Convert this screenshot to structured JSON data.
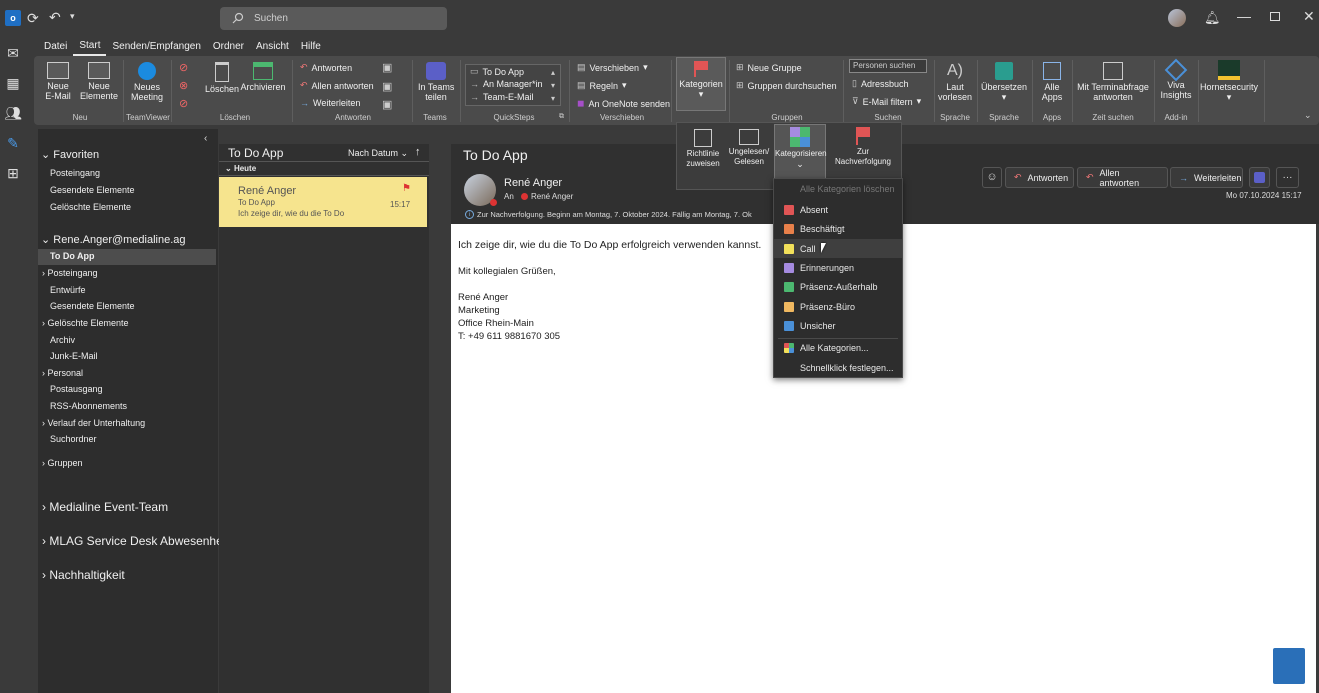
{
  "titlebar": {
    "search_placeholder": "Suchen"
  },
  "menu": [
    "Datei",
    "Start",
    "Senden/Empfangen",
    "Ordner",
    "Ansicht",
    "Hilfe"
  ],
  "ribbon": {
    "new_mail": "Neue\nE-Mail",
    "new_items": "Neue\nElemente",
    "new_meeting": "Neues\nMeeting",
    "delete": "Löschen",
    "archive": "Archivieren",
    "reply": "Antworten",
    "reply_all": "Allen antworten",
    "forward": "Weiterleiten",
    "teams_share": "In Teams\nteilen",
    "qs1": "To Do App",
    "qs2": "An Manager*in",
    "qs3": "Team-E-Mail",
    "move": "Verschieben",
    "rules": "Regeln",
    "onenote": "An OneNote senden",
    "categories": "Kategorien",
    "new_group": "Neue Gruppe",
    "browse_groups": "Gruppen durchsuchen",
    "find_people": "Personen suchen",
    "address_book": "Adressbuch",
    "filter_mail": "E-Mail filtern",
    "read_aloud": "Laut\nvorlesen",
    "translate": "Übersetzen",
    "all_apps": "Alle\nApps",
    "scheduling": "Mit Terminabfrage\nantworten",
    "viva": "Viva\nInsights",
    "hornet": "Hornetsecurity",
    "groups": [
      "Neu",
      "TeamViewer",
      "Löschen",
      "Antworten",
      "Teams",
      "QuickSteps",
      "Verschieben",
      "Gruppen",
      "Suchen",
      "Sprache",
      "Sprache",
      "Apps",
      "Zeit suchen",
      "Add-in"
    ]
  },
  "dropdown": {
    "assign_policy": "Richtlinie\nzuweisen",
    "unread_read": "Ungelesen/\nGelesen",
    "categorize": "Kategorisieren",
    "followup": "Zur\nNachverfolgung"
  },
  "category_menu": {
    "clear_all": "Alle Kategorien löschen",
    "items": [
      {
        "label": "Absent",
        "color": "#e05555"
      },
      {
        "label": "Beschäftigt",
        "color": "#e8804a"
      },
      {
        "label": "Call",
        "color": "#f2e05a"
      },
      {
        "label": "Erinnerungen",
        "color": "#a58be0"
      },
      {
        "label": "Präsenz-Außerhalb",
        "color": "#4cb870"
      },
      {
        "label": "Präsenz-Büro",
        "color": "#f0b860"
      },
      {
        "label": "Unsicher",
        "color": "#4a90d8"
      }
    ],
    "all_categories": "Alle Kategorien...",
    "quick_click": "Schnellklick festlegen..."
  },
  "folders": {
    "favorites_header": "Favoriten",
    "favorites": [
      "Posteingang",
      "Gesendete Elemente",
      "Gelöschte Elemente"
    ],
    "account": "Rene.Anger@medialine.ag",
    "account_folders": [
      "To Do App",
      "Posteingang",
      "Entwürfe",
      "Gesendete Elemente",
      "Gelöschte Elemente",
      "Archiv",
      "Junk-E-Mail",
      "Personal",
      "Postausgang",
      "RSS-Abonnements",
      "Verlauf der Unterhaltung",
      "Suchordner"
    ],
    "groups": "Gruppen",
    "shared": [
      "Medialine Event-Team",
      "MLAG Service Desk Abwesenhei...",
      "Nachhaltigkeit"
    ]
  },
  "message_list": {
    "folder": "To Do App",
    "sort": "Nach Datum",
    "group_today": "Heute",
    "item": {
      "sender": "René Anger",
      "subject": "To Do App",
      "preview": "Ich zeige dir, wie du die To Do",
      "time": "15:17"
    }
  },
  "reading": {
    "subject": "To Do App",
    "sender": "René Anger",
    "to_label": "An",
    "to": "René Anger",
    "followup_info": "Zur Nachverfolgung.  Beginn am Montag, 7. Oktober 2024.  Fällig am Montag, 7. Ok",
    "date": "Mo 07.10.2024 15:17",
    "reply": "Antworten",
    "reply_all": "Allen antworten",
    "forward": "Weiterleiten",
    "body": [
      "Ich zeige dir, wie du die To Do App erfolgreich verwenden kannst.",
      "Mit kollegialen Grüßen,",
      "René Anger",
      "Marketing",
      "Office Rhein-Main",
      "T: +49 611 9881670 305"
    ]
  }
}
